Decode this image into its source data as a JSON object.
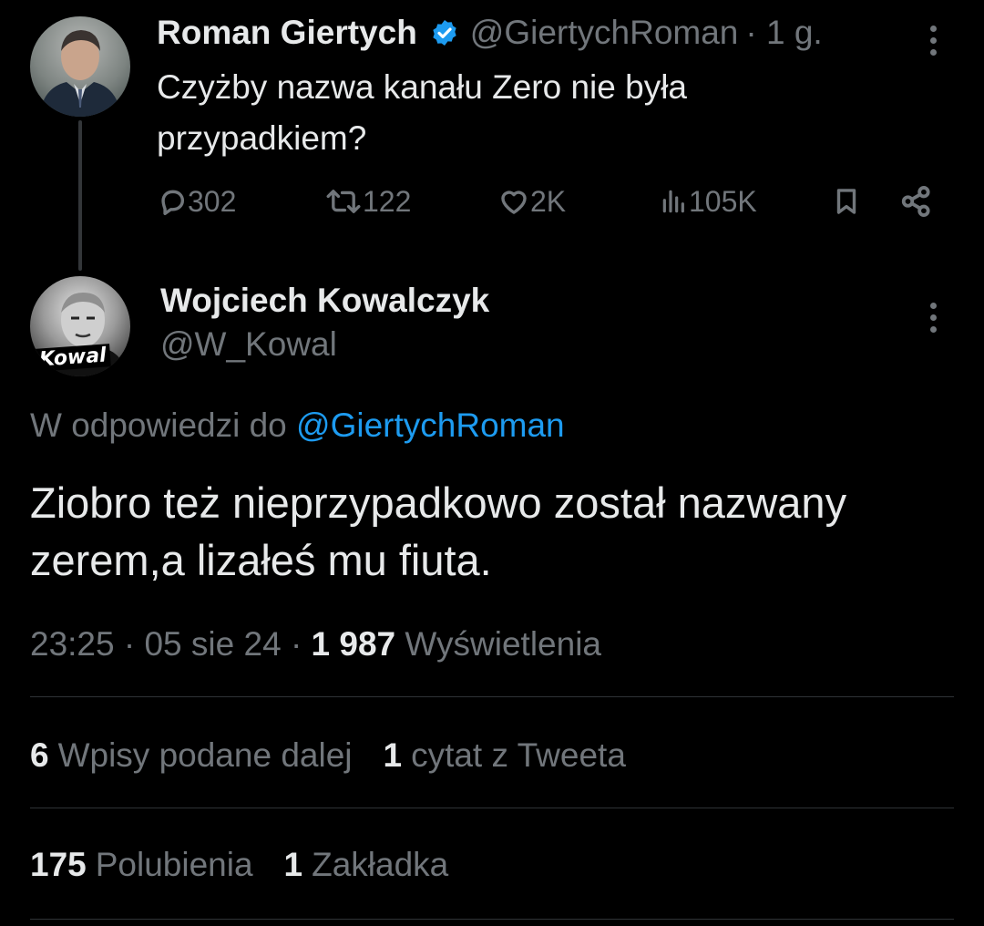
{
  "parent_tweet": {
    "author_name": "Roman Giertych",
    "author_handle": "@GiertychRoman",
    "time_ago": "· 1 g.",
    "text": "Czyżby nazwa kanału Zero nie była przypadkiem?",
    "replies": "302",
    "retweets": "122",
    "likes": "2K",
    "views": "105K"
  },
  "reply_tweet": {
    "author_name": "Wojciech Kowalczyk",
    "author_handle": "@W_Kowal",
    "avatar_overlay_text": "Kowal",
    "reply_to_prefix": "W odpowiedzi do",
    "reply_to_handle": "@GiertychRoman",
    "text": "Ziobro też nieprzypadkowo został nazwany zerem,a lizałeś mu fiuta.",
    "time": "23:25",
    "date": "05 sie 24",
    "views_count": "1 987",
    "views_label": "Wyświetlenia"
  },
  "engagement": {
    "reposts_count": "6",
    "reposts_label": "Wpisy podane dalej",
    "quotes_count": "1",
    "quotes_label": "cytat z Tweeta",
    "likes_count": "175",
    "likes_label": "Polubienia",
    "bookmarks_count": "1",
    "bookmarks_label": "Zakładka"
  },
  "colors": {
    "background": "#000000",
    "text_primary": "#e7e9ea",
    "text_muted": "#71767b",
    "accent_link": "#1d9bf0",
    "verified_badge": "#1d9bf0",
    "divider": "#2f3336"
  },
  "icons": {
    "verified": "verified-badge-icon",
    "more": "more-dots-icon",
    "reply": "reply-icon",
    "retweet": "retweet-icon",
    "like": "heart-icon",
    "views": "views-bar-icon",
    "bookmark": "bookmark-icon",
    "share": "share-icon"
  }
}
